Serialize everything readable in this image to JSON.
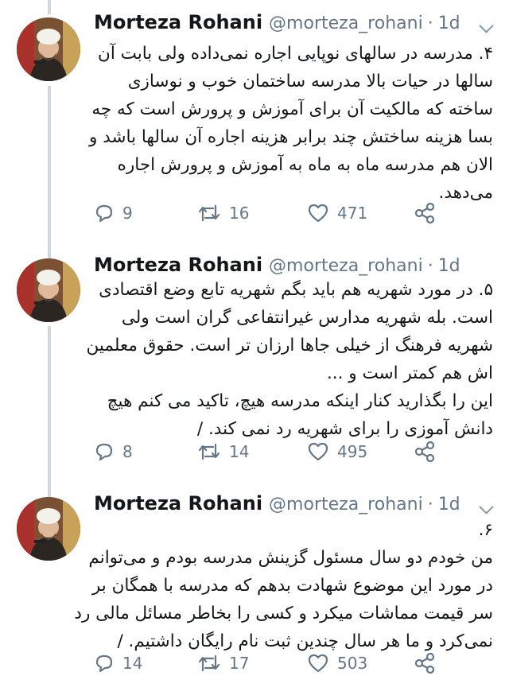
{
  "tweets": [
    {
      "name": "Morteza Rohani",
      "handle": "@morteza_rohani",
      "time": "1d",
      "lines": [
        "۴. مدرسه در سالهای نوپایی اجاره نمی‌داده ولی بابت آن",
        "سالها در حیات بالا مدرسه ساختمان خوب و نوسازی",
        "ساخته که مالکیت آن برای آموزش و پرورش است که چه",
        "بسا هزینه ساختش چند برابر هزینه اجاره آن سالها باشد و",
        "الان هم مدرسه ماه به ماه به آموزش و پرورش اجاره",
        "می‌دهد."
      ],
      "replies": "9",
      "retweets": "16",
      "likes": "471"
    },
    {
      "name": "Morteza Rohani",
      "handle": "@morteza_rohani",
      "time": "1d",
      "lines": [
        "۵. در مورد شهریه هم باید بگم شهریه تابع وضع اقتصادی",
        "است. بله شهریه مدارس غیرانتفاعی گران است ولی",
        "شهریه فرهنگ از خیلی جاها ارزان تر است. حقوق معلمین",
        "اش هم کمتر است و ...",
        "این را بگذارید کنار اینکه مدرسه هیچ، تاکید می کنم هیچ",
        "دانش آموزی را برای شهریه رد نمی کند. /"
      ],
      "replies": "8",
      "retweets": "14",
      "likes": "495"
    },
    {
      "name": "Morteza Rohani",
      "handle": "@morteza_rohani",
      "time": "1d",
      "lines": [
        "۶.",
        "من خودم دو سال مسئول گزینش مدرسه بودم و می‌توانم",
        "در مورد این موضوع شهادت بدهم که مدرسه با همگان بر",
        "سر قیمت مماشات میکرد و کسی را بخاطر مسائل مالی رد",
        "نمی‌کرد و ما هر سال چندین ثبت نام رایگان داشتیم. /"
      ],
      "replies": "14",
      "retweets": "17",
      "likes": "503"
    }
  ],
  "icons": {
    "reply": "reply-icon",
    "retweet": "retweet-icon",
    "like": "heart-icon",
    "share": "share-icon",
    "more": "chevron-down-icon"
  },
  "colors": {
    "text": "#14171a",
    "muted": "#657786",
    "thread_line": "#cfd9de"
  }
}
